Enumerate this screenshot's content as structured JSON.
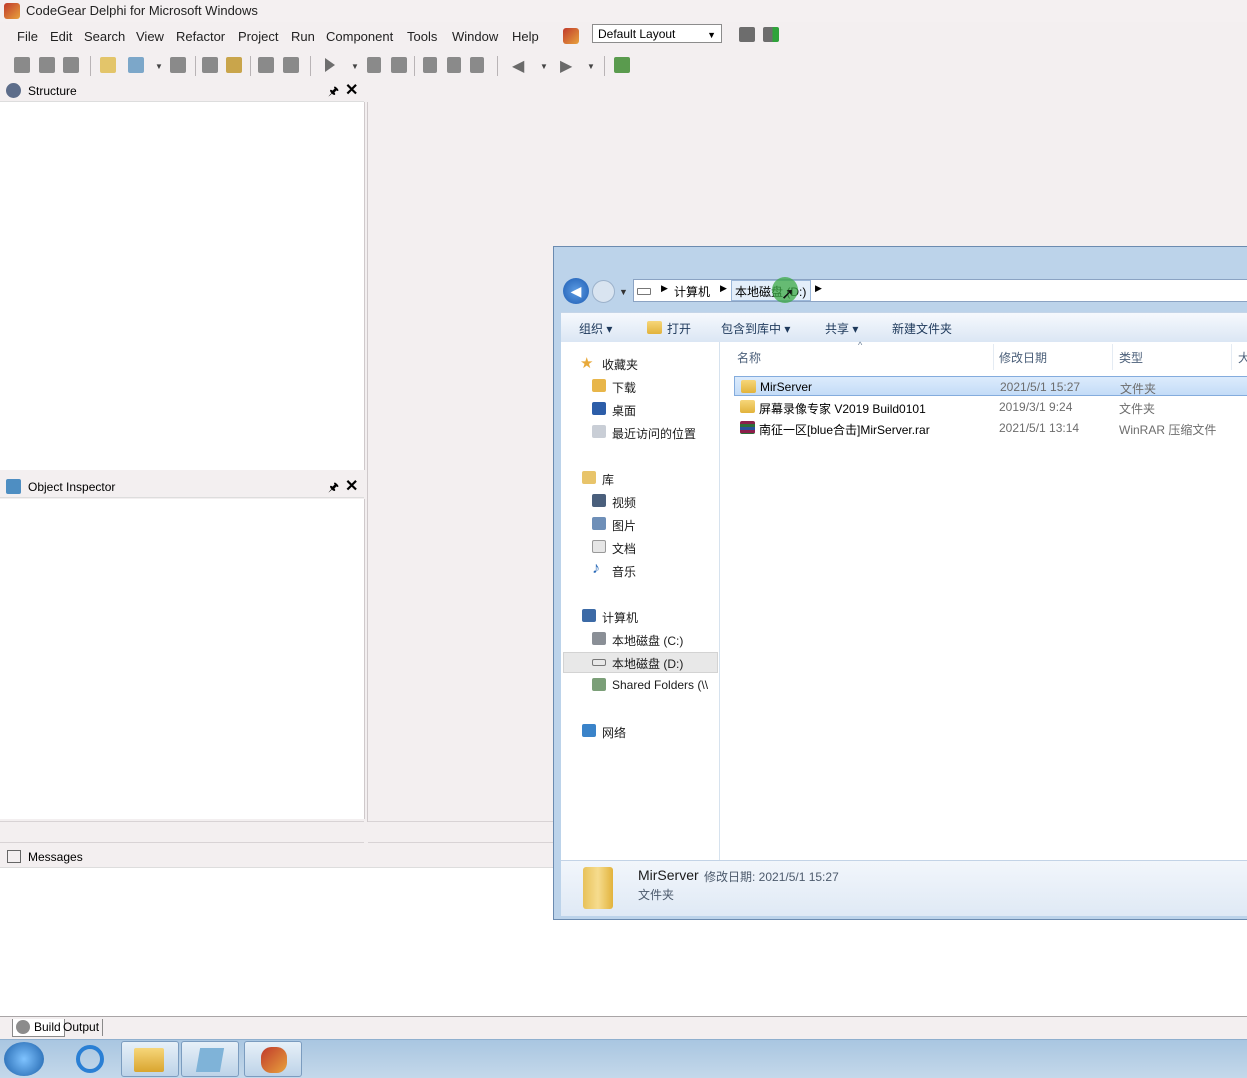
{
  "app": {
    "title": "CodeGear Delphi for Microsoft Windows",
    "menu": [
      "File",
      "Edit",
      "Search",
      "View",
      "Refactor",
      "Project",
      "Run",
      "Component",
      "Tools",
      "Window",
      "Help"
    ],
    "layout_combo": "Default Layout"
  },
  "panels": {
    "structure": "Structure",
    "object_inspector": "Object Inspector",
    "messages": "Messages",
    "pin": "ᵖ",
    "close": "✕"
  },
  "bottom_tabs": {
    "build": "Build",
    "output": "Output"
  },
  "explorer": {
    "breadcrumb": [
      "计算机",
      "本地磁盘 (D:)"
    ],
    "commands": {
      "organize": "组织 ▾",
      "open": "打开",
      "include": "包含到库中 ▾",
      "share": "共享 ▾",
      "new_folder": "新建文件夹"
    },
    "nav": {
      "favorites": "收藏夹",
      "downloads": "下载",
      "desktop": "桌面",
      "recent": "最近访问的位置",
      "libraries": "库",
      "videos": "视频",
      "pictures": "图片",
      "documents": "文档",
      "music": "音乐",
      "computer": "计算机",
      "drive_c": "本地磁盘 (C:)",
      "drive_d": "本地磁盘 (D:)",
      "shared": "Shared Folders (\\\\",
      "network": "网络"
    },
    "columns": {
      "name": "名称",
      "modified": "修改日期",
      "type": "类型",
      "size": "大"
    },
    "files": [
      {
        "name": "MirServer",
        "modified": "2021/5/1 15:27",
        "type": "文件夹"
      },
      {
        "name": "屏幕录像专家 V2019 Build0101",
        "modified": "2019/3/1 9:24",
        "type": "文件夹"
      },
      {
        "name": "南征一区[blue合击]MirServer.rar",
        "modified": "2021/5/1 13:14",
        "type": "WinRAR 压缩文件"
      }
    ],
    "details": {
      "name": "MirServer",
      "meta": "修改日期: 2021/5/1 15:27",
      "kind": "文件夹"
    }
  }
}
